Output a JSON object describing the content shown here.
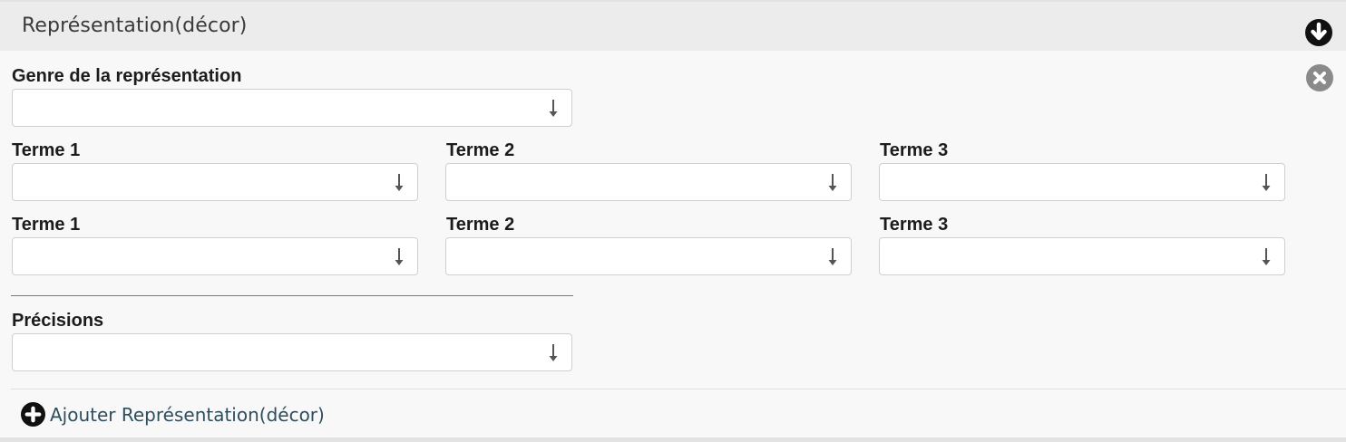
{
  "section": {
    "title": "Représentation(décor)",
    "collapse_icon": "arrow-down-circle-icon",
    "remove_icon": "close-circle-icon"
  },
  "genre": {
    "label": "Genre de la représentation",
    "value": ""
  },
  "terms_row1": [
    {
      "label": "Terme 1",
      "value": ""
    },
    {
      "label": "Terme 2",
      "value": ""
    },
    {
      "label": "Terme 3",
      "value": ""
    }
  ],
  "terms_row2": [
    {
      "label": "Terme 1",
      "value": ""
    },
    {
      "label": "Terme 2",
      "value": ""
    },
    {
      "label": "Terme 3",
      "value": ""
    }
  ],
  "precisions": {
    "label": "Précisions",
    "value": ""
  },
  "add": {
    "label": "Ajouter Représentation(décor)",
    "icon": "plus-circle-icon"
  },
  "colors": {
    "header_bg": "#ececec",
    "panel_bg": "#f8f8f8",
    "link": "#2e4e5e",
    "remove_icon": "#8a8a8a"
  }
}
